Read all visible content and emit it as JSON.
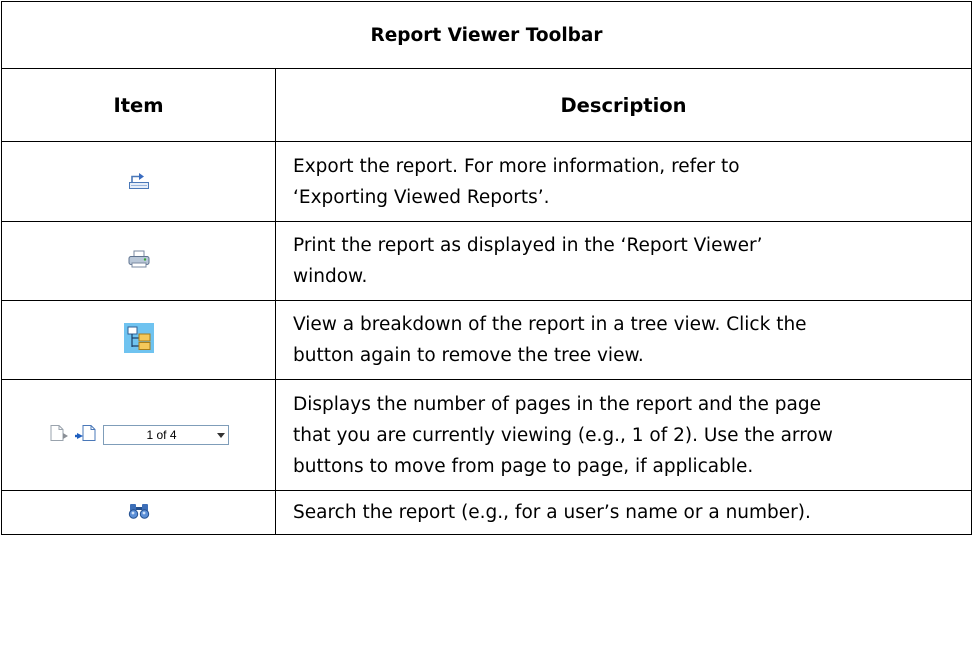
{
  "table": {
    "title": "Report Viewer Toolbar",
    "headers": {
      "item": "Item",
      "description": "Description"
    },
    "rows": [
      {
        "icon": "export-icon",
        "description_lines": [
          "Export the report. For more information, refer to",
          "‘Exporting Viewed Reports’."
        ]
      },
      {
        "icon": "print-icon",
        "description_lines": [
          "Print the report as displayed in the ‘Report Viewer’",
          "window."
        ]
      },
      {
        "icon": "tree-view-icon",
        "description_lines": [
          "View a breakdown of the report in a tree view. Click the",
          "button again to remove the tree view."
        ]
      },
      {
        "icon": "page-navigation",
        "pager": {
          "value": "1 of 4"
        },
        "description_lines": [
          "Displays the number of pages in the report and the page",
          "that you are currently viewing (e.g., 1 of 2). Use the arrow",
          "buttons to move from page to page, if applicable."
        ]
      },
      {
        "icon": "search-icon",
        "description_lines": [
          "Search the report (e.g., for a user’s name or a number)."
        ]
      }
    ]
  }
}
